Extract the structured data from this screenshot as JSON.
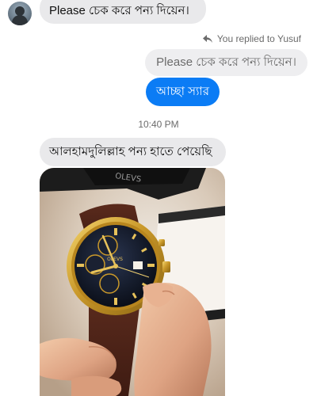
{
  "messages": {
    "first_incoming": "Please চেক করে পন্য দিয়েন।",
    "reply_indicator": "You replied to Yusuf",
    "quoted_message": "Please চেক করে পন্য দিয়েন।",
    "my_reply": "আচ্ছা স্যার",
    "timestamp": "10:40 PM",
    "second_incoming": "আলহামদুলিল্লাহ পন্য হাতে পেয়েছি"
  },
  "photo": {
    "watch_brand_text": "OLEVS"
  },
  "colors": {
    "incoming_bubble": "#e9e9eb",
    "outgoing_bubble": "#0b7cf5",
    "meta_text": "#6b6b6b"
  }
}
